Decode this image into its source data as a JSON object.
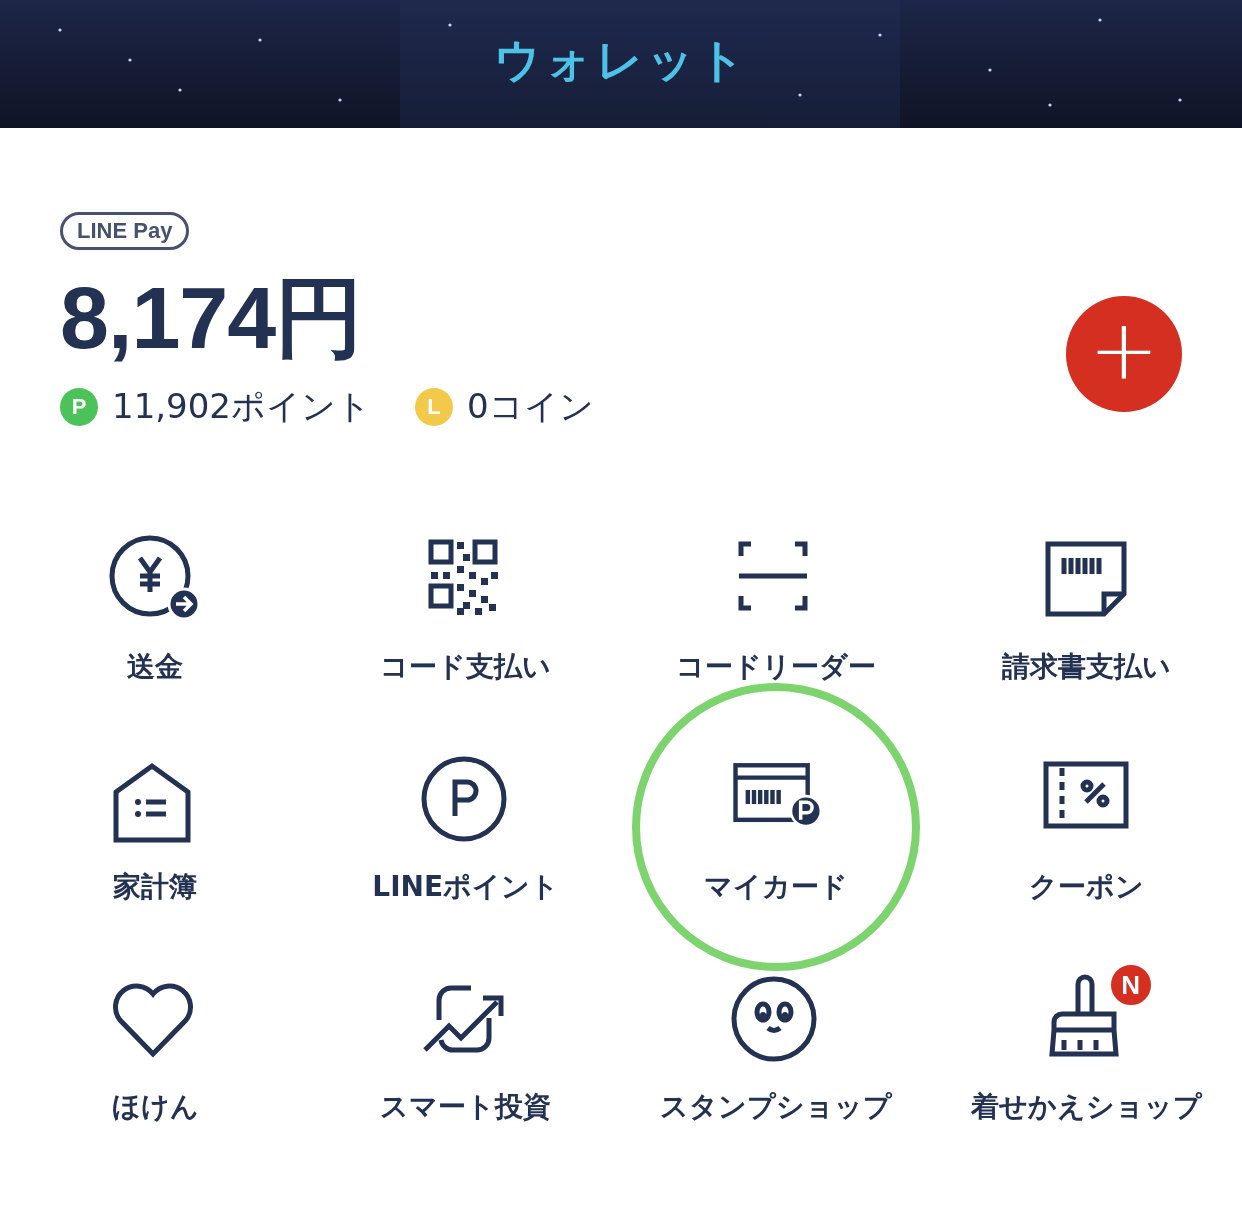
{
  "header": {
    "title": "ウォレット"
  },
  "balance": {
    "badge": "LINE Pay",
    "amount": "8,174円",
    "points": [
      {
        "kind": "line-point",
        "symbol": "P",
        "text": "11,902ポイント"
      },
      {
        "kind": "coin",
        "symbol": "L",
        "text": "0コイン"
      }
    ],
    "add_button": "+"
  },
  "menu": [
    {
      "kind": "send",
      "label": "送金",
      "highlighted": false
    },
    {
      "kind": "qr",
      "label": "コード支払い",
      "highlighted": false
    },
    {
      "kind": "reader",
      "label": "コードリーダー",
      "highlighted": false
    },
    {
      "kind": "bill",
      "label": "請求書支払い",
      "highlighted": false
    },
    {
      "kind": "house",
      "label": "家計簿",
      "highlighted": false
    },
    {
      "kind": "point",
      "label": "LINEポイント",
      "highlighted": false
    },
    {
      "kind": "card",
      "label": "マイカード",
      "highlighted": true
    },
    {
      "kind": "coupon",
      "label": "クーポン",
      "highlighted": false
    },
    {
      "kind": "heart",
      "label": "ほけん",
      "highlighted": false
    },
    {
      "kind": "chart",
      "label": "スマート投資",
      "highlighted": false
    },
    {
      "kind": "face",
      "label": "スタンプショップ",
      "highlighted": false
    },
    {
      "kind": "brush",
      "label": "着せかえショップ",
      "highlighted": false,
      "badge": "N"
    }
  ]
}
